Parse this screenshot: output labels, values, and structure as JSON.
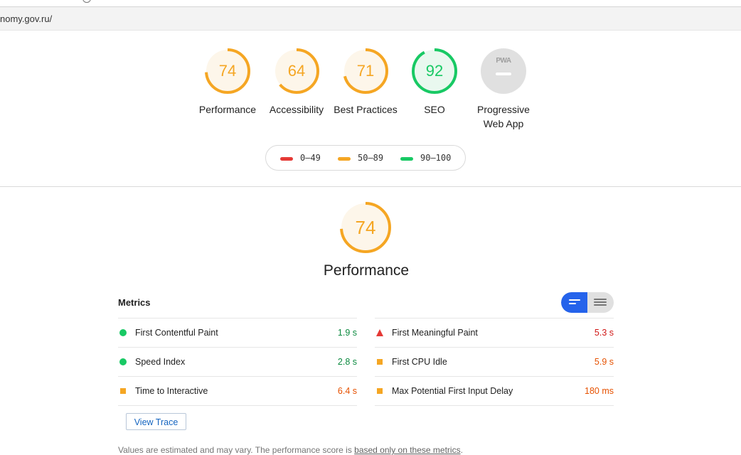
{
  "browser": {
    "url": "nomy.gov.ru/"
  },
  "colors": {
    "fail": "#e53935",
    "average": "#f5a623",
    "pass": "#18c964",
    "average_text": "#e65100",
    "pass_text": "#0b8a3f",
    "fail_text": "#d01716"
  },
  "categories": [
    {
      "label": "Performance",
      "score": 74,
      "rating": "average"
    },
    {
      "label": "Accessibility",
      "score": 64,
      "rating": "average"
    },
    {
      "label": "Best Practices",
      "score": 71,
      "rating": "average"
    },
    {
      "label": "SEO",
      "score": 92,
      "rating": "pass"
    },
    {
      "label": "Progressive Web App",
      "score": null,
      "rating": "pwa",
      "badge": "PWA"
    }
  ],
  "legend": [
    {
      "range": "0–49",
      "rating": "fail"
    },
    {
      "range": "50–89",
      "rating": "average"
    },
    {
      "range": "90–100",
      "rating": "pass"
    }
  ],
  "performance": {
    "score": 74,
    "title": "Performance",
    "metrics_heading": "Metrics",
    "metrics_left": [
      {
        "name": "First Contentful Paint",
        "value": "1.9 s",
        "rating": "pass"
      },
      {
        "name": "Speed Index",
        "value": "2.8 s",
        "rating": "pass"
      },
      {
        "name": "Time to Interactive",
        "value": "6.4 s",
        "rating": "average"
      }
    ],
    "metrics_right": [
      {
        "name": "First Meaningful Paint",
        "value": "5.3 s",
        "rating": "fail"
      },
      {
        "name": "First CPU Idle",
        "value": "5.9 s",
        "rating": "average"
      },
      {
        "name": "Max Potential First Input Delay",
        "value": "180 ms",
        "rating": "average"
      }
    ],
    "view_trace_label": "View Trace",
    "note_prefix": "Values are estimated and may vary. The performance score is ",
    "note_link": "based only on these metrics",
    "note_suffix": "."
  }
}
